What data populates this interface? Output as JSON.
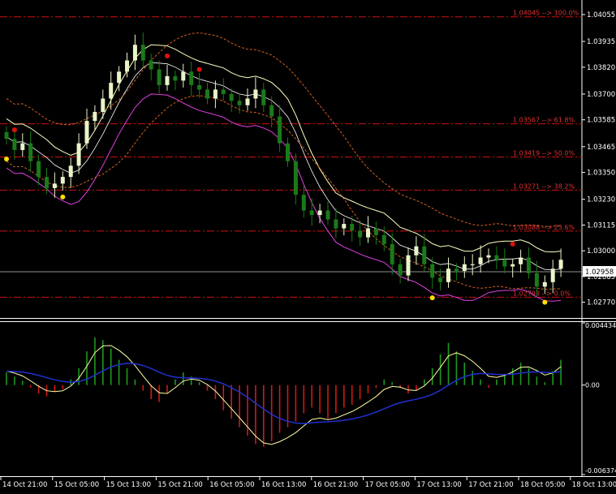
{
  "price_axis": [
    "1.04055",
    "1.03935",
    "1.03820",
    "1.03700",
    "1.03585",
    "1.03465",
    "1.03350",
    "1.03230",
    "1.03115",
    "1.03000",
    "1.02885",
    "1.02770"
  ],
  "current_price": "1.02958",
  "fib_levels": [
    {
      "label": "1.04045 --> 100.0%",
      "price": 1.04045
    },
    {
      "label": "1.03567 --> 61.8%",
      "price": 1.03567
    },
    {
      "label": "1.03419 --> 50.0%",
      "price": 1.03419
    },
    {
      "label": "1.03271 --> 38.2%",
      "price": 1.03271
    },
    {
      "label": "1.03088 --> 23.6%",
      "price": 1.03088
    },
    {
      "label": "1.02793 --> 0.0%",
      "price": 1.02793
    }
  ],
  "osc_axis": {
    "top": "0.004434",
    "zero": "0.00",
    "bottom": "-0.006374"
  },
  "time_axis": [
    "14 Oct 21:00",
    "15 Oct 05:00",
    "15 Oct 13:00",
    "15 Oct 21:00",
    "16 Oct 05:00",
    "16 Oct 13:00",
    "16 Oct 21:00",
    "17 Oct 05:00",
    "17 Oct 13:00",
    "17 Oct 21:00",
    "18 Oct 05:00",
    "18 Oct 13:00"
  ],
  "colors": {
    "background": "#000000",
    "bull_candle": "#e8f5c8",
    "bear_candle": "#1a7a1a",
    "fib": "#d01010",
    "fib_label": "#e03030",
    "channel": "#d06020",
    "band_upper": "#ffffc0",
    "band_lower": "#e040e0",
    "osc_signal": "#ffffa0",
    "osc_ma": "#2030d0",
    "hist_up": "#1d9a1d",
    "hist_down": "#d01818",
    "grid_text": "#ffffff"
  },
  "chart_data": [
    {
      "type": "candlestick",
      "title": "",
      "ylim": [
        1.027,
        1.0412
      ],
      "closes": [
        1.035,
        1.0345,
        1.0348,
        1.034,
        1.0333,
        1.0328,
        1.033,
        1.0333,
        1.0338,
        1.0348,
        1.0358,
        1.0362,
        1.0368,
        1.0375,
        1.038,
        1.0385,
        1.0392,
        1.0385,
        1.0381,
        1.0374,
        1.0378,
        1.0376,
        1.038,
        1.0374,
        1.0372,
        1.0368,
        1.0372,
        1.037,
        1.0367,
        1.0365,
        1.0368,
        1.0372,
        1.0365,
        1.036,
        1.0348,
        1.034,
        1.0325,
        1.0318,
        1.0316,
        1.0318,
        1.0314,
        1.031,
        1.0312,
        1.0309,
        1.0306,
        1.031,
        1.0307,
        1.0303,
        1.0294,
        1.0289,
        1.0298,
        1.0302,
        1.0294,
        1.0288,
        1.0286,
        1.0292,
        1.0291,
        1.0294,
        1.0294,
        1.0297,
        1.0298,
        1.0296,
        1.0293,
        1.0294,
        1.0297,
        1.029,
        1.0284,
        1.0286,
        1.0292,
        1.0296
      ],
      "fib_prices": [
        1.04045,
        1.03567,
        1.03419,
        1.03271,
        1.03088,
        1.02793
      ]
    },
    {
      "type": "histogram",
      "title": "",
      "ylim": [
        -0.006374,
        0.004434
      ],
      "values": [
        0.0009,
        0.0006,
        0.0003,
        -0.0002,
        -0.0006,
        -0.0008,
        -0.0005,
        -0.0003,
        0.0004,
        0.0012,
        0.0024,
        0.0034,
        0.0032,
        0.0026,
        0.0018,
        0.0012,
        0.0004,
        -0.0004,
        -0.001,
        -0.0012,
        -0.0006,
        0.0004,
        0.0009,
        0.0006,
        0.0002,
        -0.0004,
        -0.001,
        -0.0018,
        -0.0024,
        -0.003,
        -0.0036,
        -0.0042,
        -0.0044,
        -0.004,
        -0.0034,
        -0.003,
        -0.0026,
        -0.002,
        -0.0016,
        -0.002,
        -0.0024,
        -0.002,
        -0.0016,
        -0.0014,
        -0.001,
        -0.0006,
        -0.0002,
        0.0004,
        0.0002,
        -0.0002,
        -0.0006,
        -0.0004,
        0.0004,
        0.0012,
        0.0022,
        0.003,
        0.0024,
        0.0016,
        0.001,
        0.0004,
        -0.0002,
        0.0004,
        0.0008,
        0.0012,
        0.0016,
        0.0012,
        0.0006,
        0.0002,
        0.001,
        0.0018
      ]
    }
  ]
}
